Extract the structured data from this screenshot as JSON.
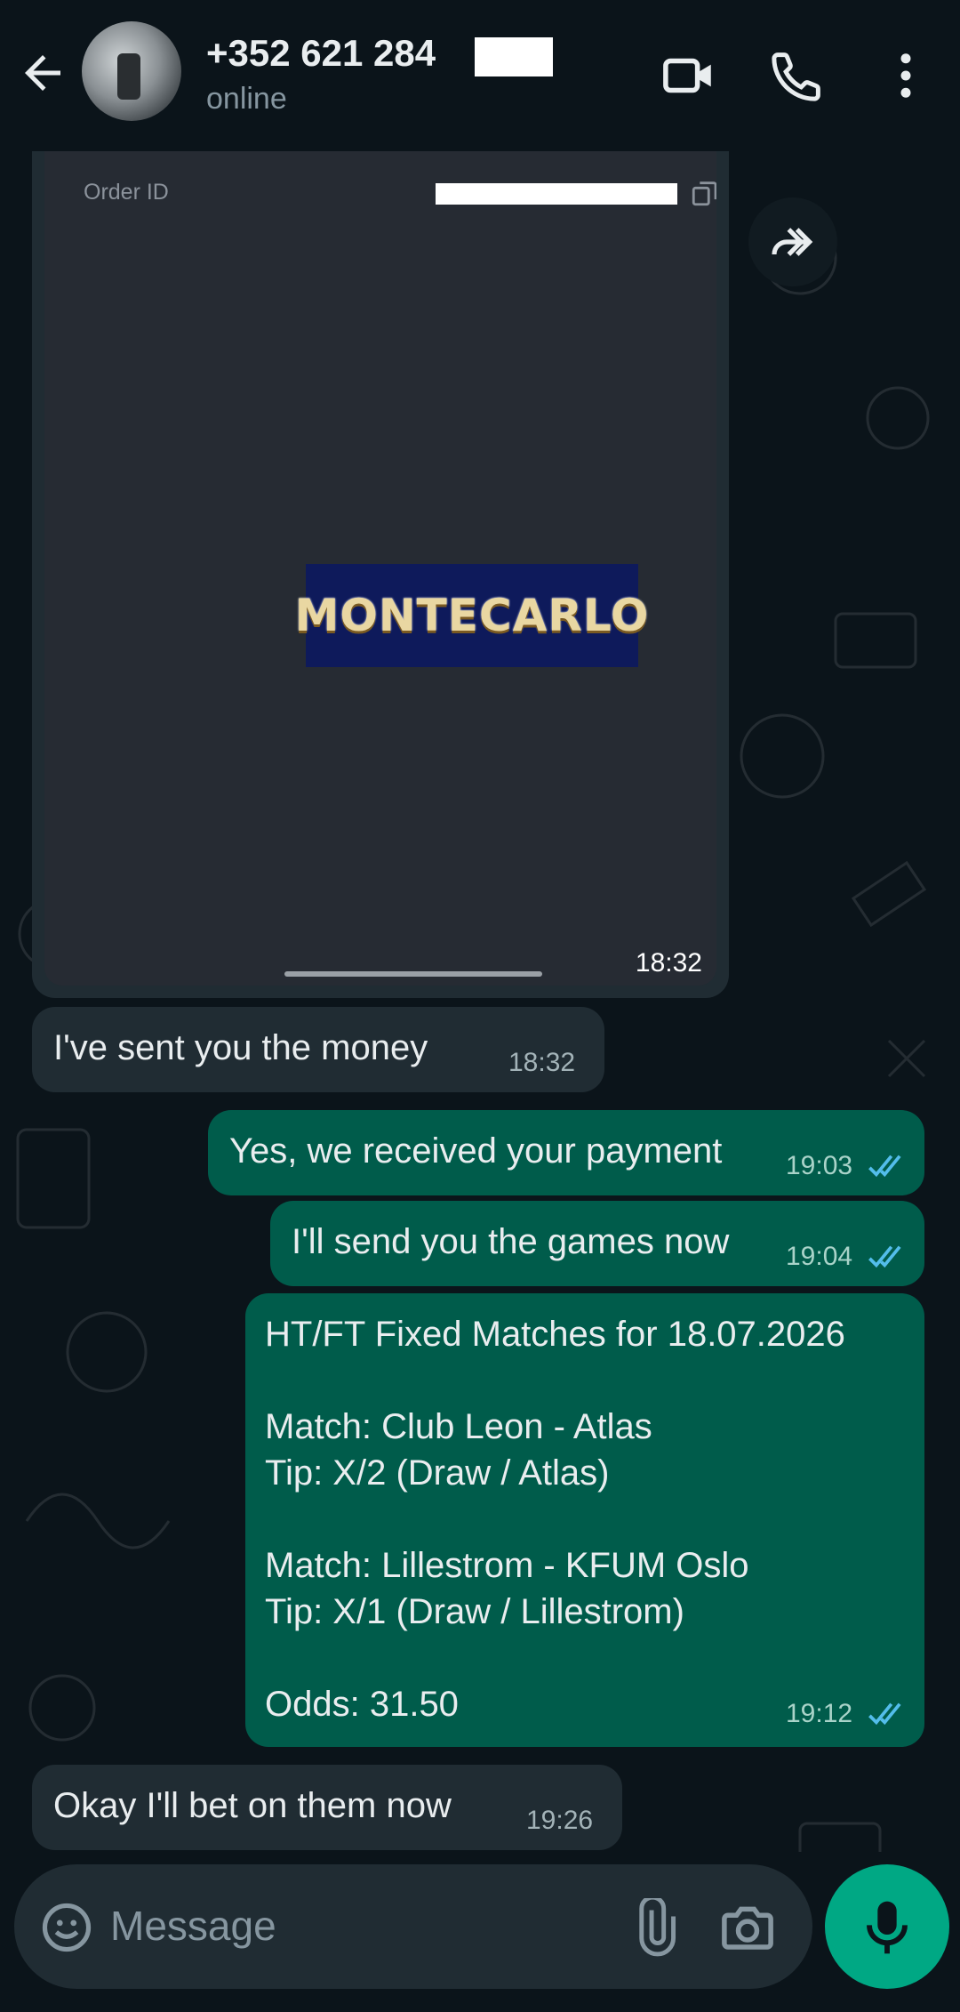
{
  "header": {
    "title": "+352 621 284",
    "status": "online"
  },
  "image_message": {
    "order_label": "Order ID",
    "logo_text": "MONTECARLO",
    "time": "18:32"
  },
  "messages": [
    {
      "text": "I've sent you the money",
      "time": "18:32",
      "direction": "in"
    },
    {
      "text": "Yes, we received your payment",
      "time": "19:03",
      "direction": "out",
      "read": true
    },
    {
      "text": "I'll send you the games now",
      "time": "19:04",
      "direction": "out",
      "read": true
    },
    {
      "lines": [
        "HT/FT Fixed Matches for 18.07.2026",
        "",
        "Match: Club Leon - Atlas",
        "Tip: X/2 (Draw / Atlas)",
        "",
        "Match: Lillestrom - KFUM Oslo",
        "Tip: X/1 (Draw / Lillestrom)",
        "",
        "Odds: 31.50"
      ],
      "time": "19:12",
      "direction": "out",
      "read": true
    },
    {
      "text": "Okay I'll bet on them now",
      "time": "19:26",
      "direction": "in"
    }
  ],
  "composer": {
    "placeholder": "Message"
  },
  "colors": {
    "background": "#0b141a",
    "incoming_bubble": "#202c33",
    "outgoing_bubble": "#005c4b",
    "accent": "#00a884",
    "read_ticks": "#53bdeb"
  },
  "icons": [
    "back-arrow-icon",
    "video-call-icon",
    "voice-call-icon",
    "more-vert-icon",
    "copy-icon",
    "forward-icon",
    "double-check-icon",
    "emoji-icon",
    "attach-icon",
    "camera-icon",
    "mic-icon"
  ]
}
